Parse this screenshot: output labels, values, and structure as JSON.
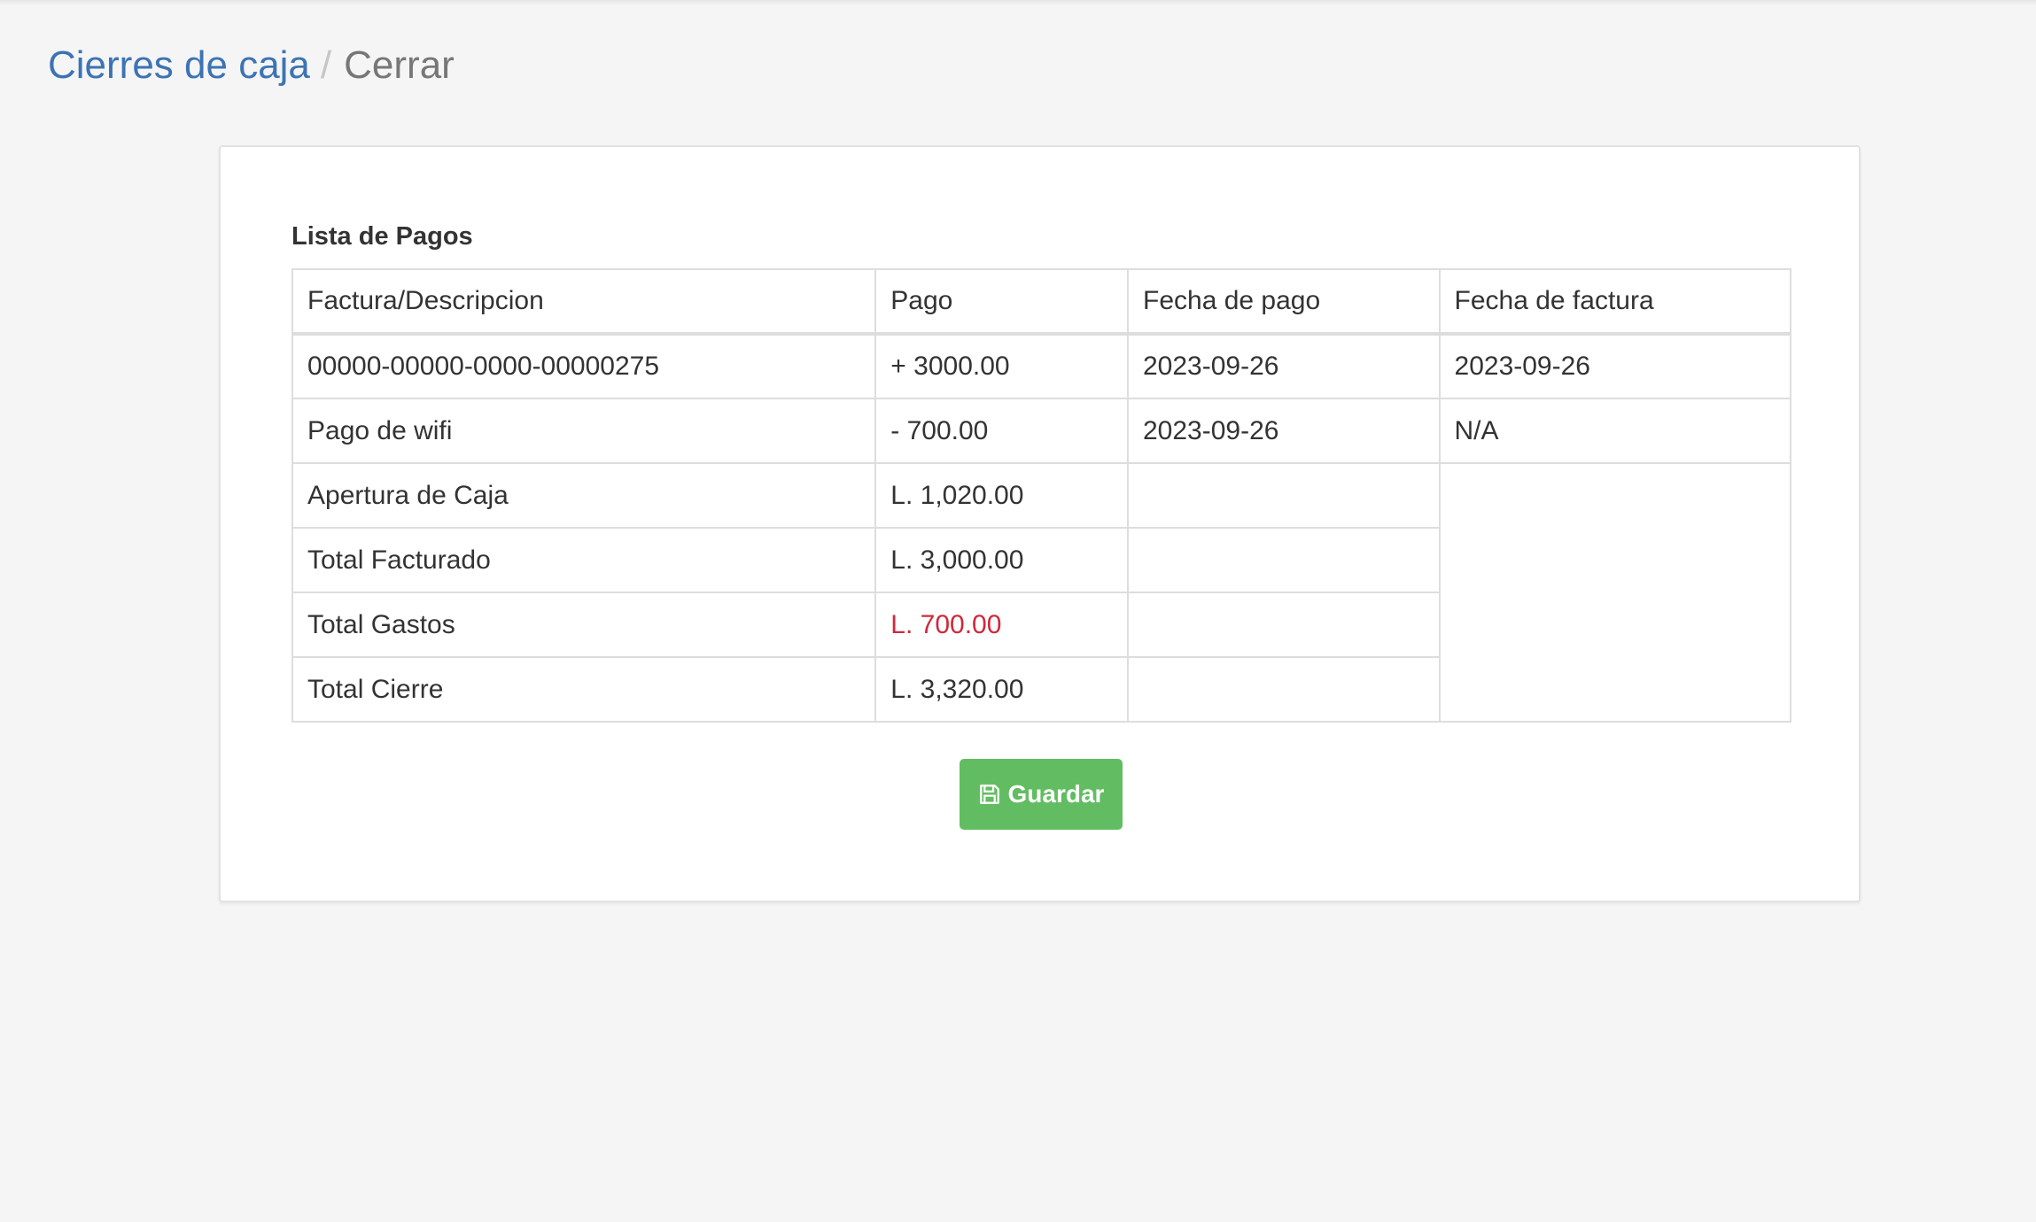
{
  "breadcrumb": {
    "parent": "Cierres de caja",
    "separator": "/",
    "current": "Cerrar"
  },
  "panel": {
    "title": "Lista de Pagos"
  },
  "table": {
    "headers": [
      "Factura/Descripcion",
      "Pago",
      "Fecha de pago",
      "Fecha de factura"
    ],
    "rows": [
      [
        "00000-00000-0000-00000275",
        "+ 3000.00",
        "2023-09-26",
        "2023-09-26"
      ],
      [
        "Pago de wifi",
        "- 700.00",
        "2023-09-26",
        "N/A"
      ]
    ],
    "totals": [
      {
        "label": "Apertura de Caja",
        "value": "L. 1,020.00"
      },
      {
        "label": "Total Facturado",
        "value": "L. 3,000.00"
      },
      {
        "label": "Total Gastos",
        "value": "L. 700.00"
      },
      {
        "label": "Total Cierre",
        "value": "L. 3,320.00"
      }
    ]
  },
  "actions": {
    "save_label": "Guardar",
    "save_icon": "floppy-disk-icon"
  },
  "colors": {
    "link": "#3c73b4",
    "success": "#62bd62",
    "danger": "#d0283a"
  }
}
